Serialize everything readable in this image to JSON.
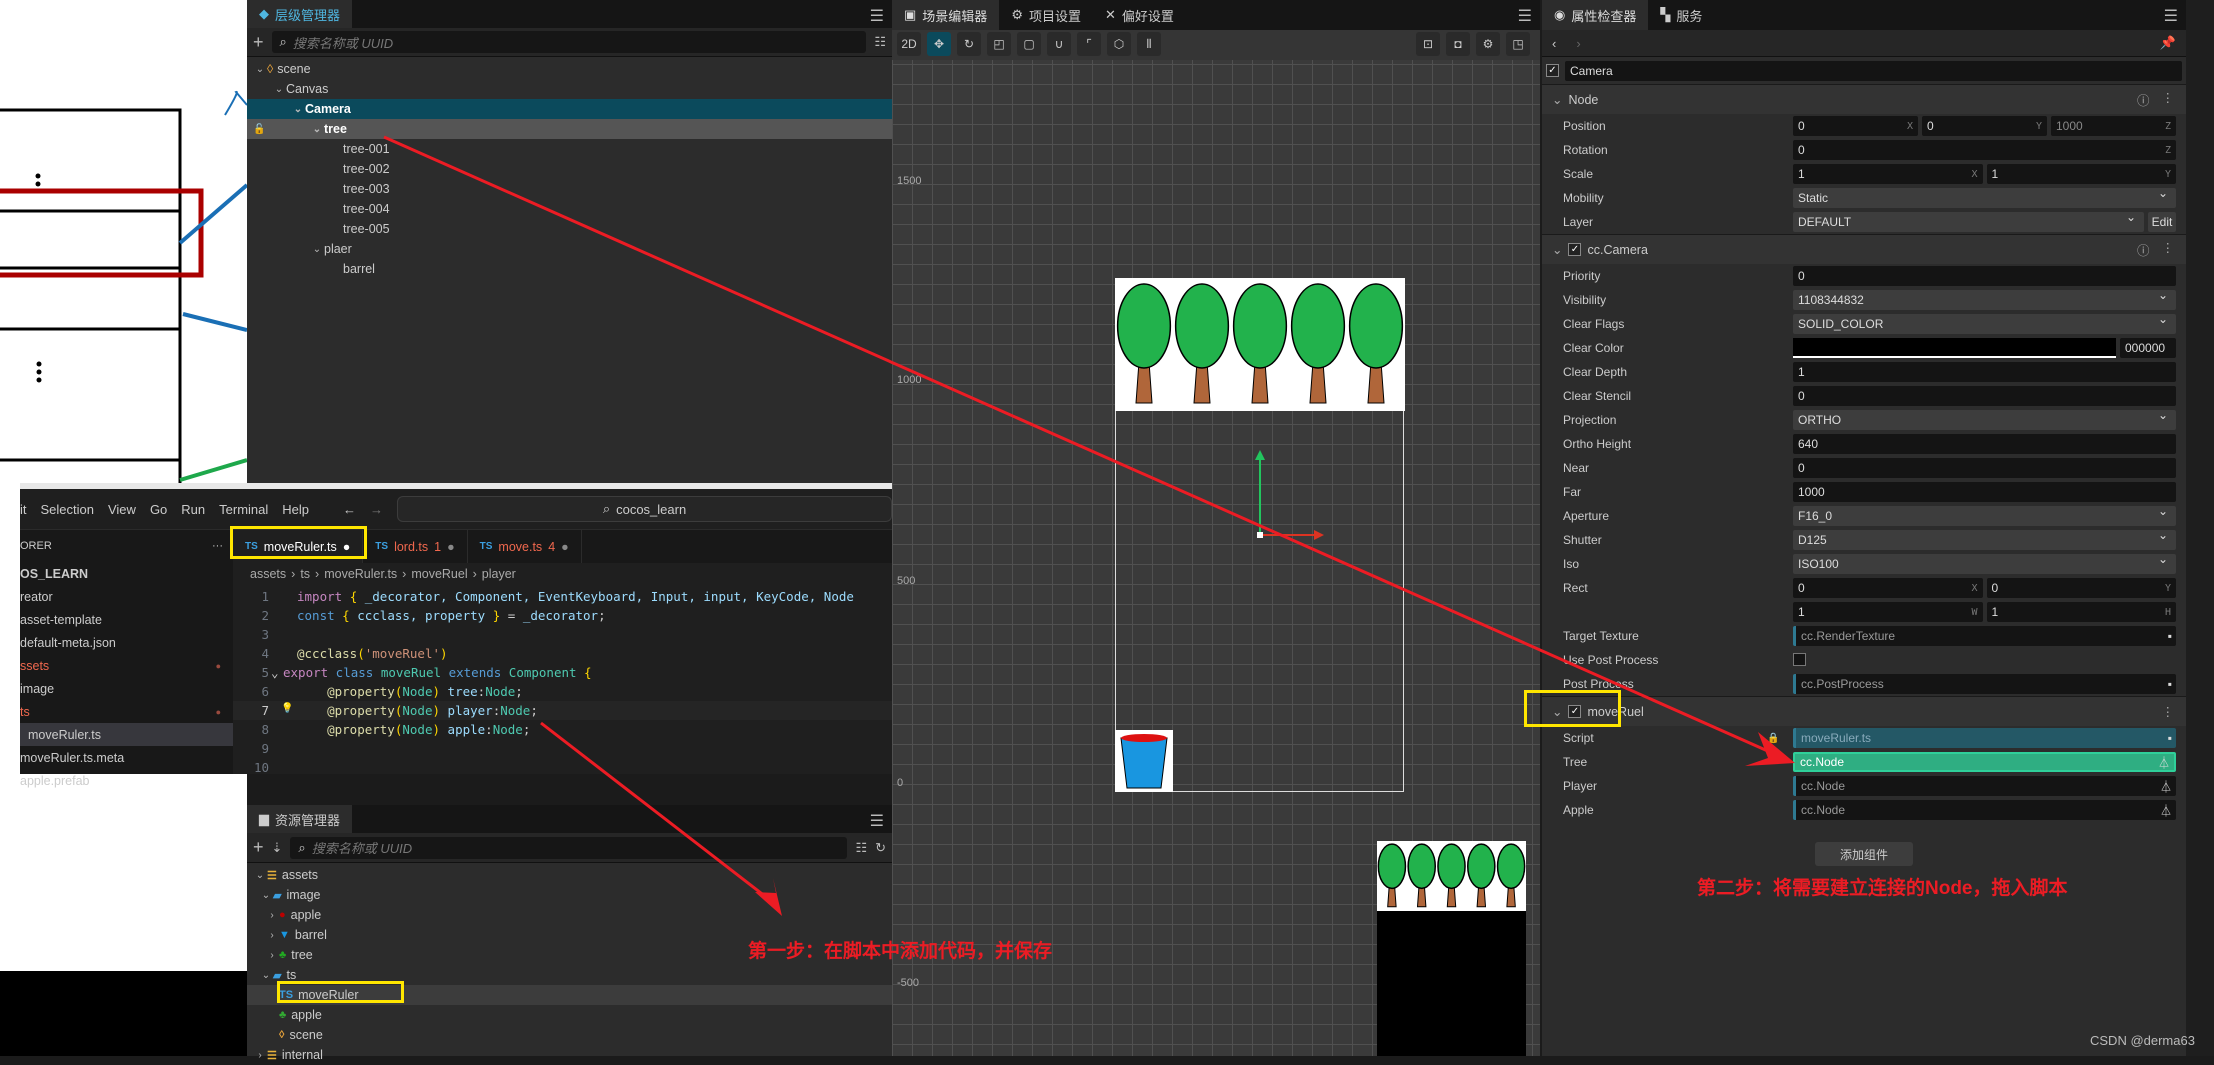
{
  "hierarchy": {
    "title": "层级管理器",
    "search_placeholder": "搜索名称或 UUID",
    "nodes": [
      {
        "label": "scene",
        "depth": 0,
        "icon": "scene-icon",
        "expanded": true
      },
      {
        "label": "Canvas",
        "depth": 1,
        "expanded": true
      },
      {
        "label": "Camera",
        "depth": 2,
        "expanded": true,
        "state": "selected"
      },
      {
        "label": "tree",
        "depth": 3,
        "expanded": true,
        "state": "hover"
      },
      {
        "label": "tree-001",
        "depth": 4
      },
      {
        "label": "tree-002",
        "depth": 4
      },
      {
        "label": "tree-003",
        "depth": 4
      },
      {
        "label": "tree-004",
        "depth": 4
      },
      {
        "label": "tree-005",
        "depth": 4
      },
      {
        "label": "plaer",
        "depth": 3,
        "expanded": true
      },
      {
        "label": "barrel",
        "depth": 4
      }
    ]
  },
  "assets": {
    "title": "资源管理器",
    "search_placeholder": "搜索名称或 UUID",
    "items": [
      {
        "label": "assets",
        "depth": 0,
        "chev": "v",
        "icon": "db"
      },
      {
        "label": "image",
        "depth": 1,
        "chev": "v",
        "icon": "folder"
      },
      {
        "label": "apple",
        "depth": 2,
        "chev": ">",
        "icon": "apple"
      },
      {
        "label": "barrel",
        "depth": 2,
        "chev": ">",
        "icon": "barrel"
      },
      {
        "label": "tree",
        "depth": 2,
        "chev": ">",
        "icon": "tree"
      },
      {
        "label": "ts",
        "depth": 1,
        "chev": "v",
        "icon": "folder"
      },
      {
        "label": "moveRuler",
        "depth": 2,
        "icon": "ts",
        "state": "selected"
      },
      {
        "label": "apple",
        "depth": 2,
        "icon": "prefab"
      },
      {
        "label": "scene",
        "depth": 2,
        "icon": "scene"
      },
      {
        "label": "internal",
        "depth": 0,
        "chev": ">",
        "icon": "db"
      }
    ]
  },
  "scene": {
    "tabs": [
      "场景编辑器",
      "项目设置",
      "偏好设置"
    ],
    "mode_2d": "2D",
    "axis_labels": [
      "1500",
      "1000",
      "500",
      "0",
      "-500"
    ]
  },
  "inspector": {
    "tabs": [
      "属性检查器",
      "服务"
    ],
    "node_name": "Camera",
    "sections": [
      {
        "title": "Node",
        "has_check": false,
        "rows": [
          {
            "label": "Position",
            "fields": [
              {
                "v": "0",
                "ax": "X"
              },
              {
                "v": "0",
                "ax": "Y"
              },
              {
                "v": "1000",
                "ax": "Z",
                "dis": true
              }
            ]
          },
          {
            "label": "Rotation",
            "fields": [
              {
                "v": "0",
                "ax": "Z"
              }
            ]
          },
          {
            "label": "Scale",
            "fields": [
              {
                "v": "1",
                "ax": "X"
              },
              {
                "v": "1",
                "ax": "Y"
              }
            ]
          },
          {
            "label": "Mobility",
            "select": "Static"
          },
          {
            "label": "Layer",
            "select": "DEFAULT",
            "button": "Edit"
          }
        ]
      },
      {
        "title": "cc.Camera",
        "has_check": true,
        "rows": [
          {
            "label": "Priority",
            "fields": [
              {
                "v": "0"
              }
            ]
          },
          {
            "label": "Visibility",
            "select": "1108344832"
          },
          {
            "label": "Clear Flags",
            "select": "SOLID_COLOR"
          },
          {
            "label": "Clear Color",
            "color": "#000000",
            "hex": "000000"
          },
          {
            "label": "Clear Depth",
            "fields": [
              {
                "v": "1"
              }
            ]
          },
          {
            "label": "Clear Stencil",
            "fields": [
              {
                "v": "0"
              }
            ]
          },
          {
            "label": "Projection",
            "select": "ORTHO"
          },
          {
            "label": "Ortho Height",
            "fields": [
              {
                "v": "640"
              }
            ]
          },
          {
            "label": "Near",
            "fields": [
              {
                "v": "0"
              }
            ]
          },
          {
            "label": "Far",
            "fields": [
              {
                "v": "1000"
              }
            ]
          },
          {
            "label": "Aperture",
            "select": "F16_0"
          },
          {
            "label": "Shutter",
            "select": "D125"
          },
          {
            "label": "Iso",
            "select": "ISO100"
          },
          {
            "label": "Rect",
            "fields": [
              {
                "v": "0",
                "ax": "X"
              },
              {
                "v": "0",
                "ax": "Y"
              }
            ]
          },
          {
            "label": "",
            "fields": [
              {
                "v": "1",
                "ax": "W"
              },
              {
                "v": "1",
                "ax": "H"
              }
            ]
          },
          {
            "label": "Target Texture",
            "ref": "cc.RenderTexture"
          },
          {
            "label": "Use Post Process",
            "checkbox": false
          },
          {
            "label": "Post Process",
            "ref": "cc.PostProcess"
          }
        ]
      },
      {
        "title": "moveRuel",
        "has_check": true,
        "rows": [
          {
            "label": "Script",
            "ref": "moveRuler.ts",
            "kind": "script"
          },
          {
            "label": "Tree",
            "ref": "cc.Node",
            "kind": "hl"
          },
          {
            "label": "Player",
            "ref": "cc.Node"
          },
          {
            "label": "Apple",
            "ref": "cc.Node"
          }
        ]
      }
    ],
    "add_component": "添加组件"
  },
  "vscode": {
    "menu": [
      "it",
      "Selection",
      "View",
      "Go",
      "Run",
      "Terminal",
      "Help"
    ],
    "search": "cocos_learn",
    "explorer_title": "ORER",
    "explorer": [
      {
        "label": "OS_LEARN",
        "bold": true
      },
      {
        "label": "reator"
      },
      {
        "label": "asset-template"
      },
      {
        "label": "default-meta.json"
      },
      {
        "label": "ssets",
        "mod": true
      },
      {
        "label": "image"
      },
      {
        "label": "ts",
        "mod": true
      },
      {
        "label": "moveRuler.ts",
        "active": true
      },
      {
        "label": "moveRuler.ts.meta"
      },
      {
        "label": "apple.prefab"
      }
    ],
    "tabs": [
      {
        "label": "moveRuler.ts",
        "badge": "",
        "active": true
      },
      {
        "label": "lord.ts",
        "badge": "1"
      },
      {
        "label": "move.ts",
        "badge": "4"
      }
    ],
    "breadcrumb": [
      "assets",
      "ts",
      "moveRuler.ts",
      "moveRuel",
      "player"
    ],
    "code": [
      [
        [
          "import",
          "kw"
        ],
        [
          " ",
          "p"
        ],
        [
          "{",
          "br"
        ],
        [
          " _decorator, Component, EventKeyboard, Input, input, KeyCode, Node",
          "id"
        ]
      ],
      [
        [
          "const",
          "st"
        ],
        [
          " ",
          "p"
        ],
        [
          "{",
          "br"
        ],
        [
          " ccclass, property ",
          "id"
        ],
        [
          "}",
          "br"
        ],
        [
          " = ",
          "p"
        ],
        [
          "_decorator",
          "id"
        ],
        [
          ";",
          "p"
        ]
      ],
      [],
      [
        [
          "@ccclass",
          "fn"
        ],
        [
          "(",
          "br"
        ],
        [
          "'moveRuel'",
          "str"
        ],
        [
          ")",
          "br"
        ]
      ],
      [
        [
          "export",
          "kw"
        ],
        [
          " class ",
          "st"
        ],
        [
          "moveRuel",
          "ty"
        ],
        [
          " extends ",
          "st"
        ],
        [
          "Component",
          "ty"
        ],
        [
          " {",
          "br"
        ]
      ],
      [
        [
          "    @property",
          "fn"
        ],
        [
          "(",
          "br"
        ],
        [
          "Node",
          "ty"
        ],
        [
          ")",
          "br"
        ],
        [
          " tree",
          "id"
        ],
        [
          ":",
          "p"
        ],
        [
          "Node",
          "ty"
        ],
        [
          ";",
          "p"
        ]
      ],
      [
        [
          "    @property",
          "fn"
        ],
        [
          "(",
          "br"
        ],
        [
          "Node",
          "ty"
        ],
        [
          ")",
          "br"
        ],
        [
          " player",
          "id"
        ],
        [
          ":",
          "p"
        ],
        [
          "Node",
          "ty"
        ],
        [
          ";",
          "p"
        ]
      ],
      [
        [
          "    @property",
          "fn"
        ],
        [
          "(",
          "br"
        ],
        [
          "Node",
          "ty"
        ],
        [
          ")",
          "br"
        ],
        [
          " apple",
          "id"
        ],
        [
          ":",
          "p"
        ],
        [
          "Node",
          "ty"
        ],
        [
          ";",
          "p"
        ]
      ],
      [],
      []
    ]
  },
  "annotations": {
    "step1": "第一步：在脚本中添加代码，并保存",
    "step2": "第二步：将需要建立连接的Node，拖入脚本"
  },
  "watermark": "CSDN @derma63",
  "colors": {
    "accent": "#4fb6e0",
    "selected_row": "#0b4a5c",
    "highlight_field": "#2fae82",
    "annotation": "#ec1c24",
    "highlight_box": "#ffe600"
  }
}
